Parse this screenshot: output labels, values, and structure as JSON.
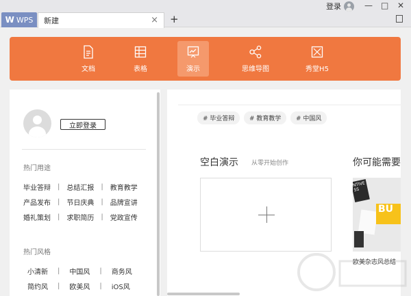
{
  "titlebar": {
    "logo_label": "WPS",
    "tab_label": "新建",
    "tab_close": "×",
    "new_tab": "+",
    "login_label": "登录",
    "minimize": "—",
    "restore": "□",
    "close": "✕"
  },
  "toolbar": {
    "items": [
      {
        "label": "文档",
        "icon": "document-icon"
      },
      {
        "label": "表格",
        "icon": "table-icon"
      },
      {
        "label": "演示",
        "icon": "presentation-icon",
        "active": true
      },
      {
        "label": "思维导图",
        "icon": "mindmap-icon"
      },
      {
        "label": "秀堂H5",
        "icon": "h5-icon"
      }
    ],
    "color": "#f07840"
  },
  "left": {
    "login_button": "立即登录",
    "hot_use_title": "热门用途",
    "hot_use_rows": [
      [
        "毕业答辩",
        "总结汇报",
        "教育教学"
      ],
      [
        "产品发布",
        "节日庆典",
        "品牌宣讲"
      ],
      [
        "婚礼策划",
        "求职简历",
        "党政宣传"
      ]
    ],
    "hot_style_title": "热门风格",
    "hot_style_rows": [
      [
        "小清新",
        "中国风",
        "商务风"
      ],
      [
        "简约风",
        "欧美风",
        "iOS风"
      ]
    ],
    "separator": "|"
  },
  "right": {
    "chips": [
      "# 毕业答辩",
      "# 教育教学",
      "# 中国风"
    ],
    "blank_title": "空白演示",
    "blank_sub": "从零开始创作",
    "maybe_title": "你可能需要",
    "template_caption": "欧美杂志风总结",
    "thumb_text_dark": "NTIVE SS",
    "thumb_text_yellow": "BU"
  }
}
